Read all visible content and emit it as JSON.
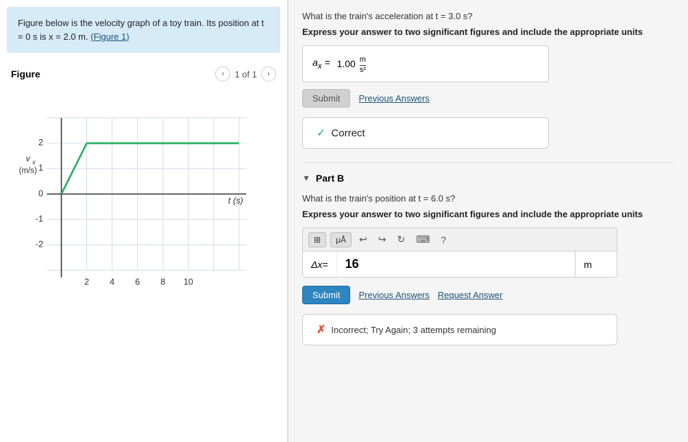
{
  "left": {
    "description": "Figure below is the velocity graph of a toy train. Its position at t = 0 s is x = 2.0 m.",
    "figure_link": "(Figure 1)",
    "figure_label": "Figure",
    "nav_text": "1 of 1",
    "graph": {
      "x_label": "t (s)",
      "y_label": "vₓ (m/s)",
      "x_ticks": [
        "2",
        "4",
        "6",
        "8",
        "10"
      ],
      "y_ticks": [
        "2",
        "1",
        "0",
        "-1",
        "-2"
      ]
    }
  },
  "right": {
    "part_a": {
      "question": "What is the train's acceleration at t = 3.0 s?",
      "instruction": "Express your answer to two significant figures and include the appropriate units",
      "answer_label": "aₓ =",
      "answer_value": "1.00",
      "answer_unit_num": "m",
      "answer_unit_den": "s²",
      "submit_label": "Submit",
      "prev_answers_label": "Previous Answers",
      "correct_label": "Correct"
    },
    "part_b": {
      "part_label": "Part B",
      "question": "What is the train's position at t = 6.0 s?",
      "instruction": "Express your answer to two significant figures and include the appropriate units",
      "toolbar_btns": [
        "⊞",
        "μÅ"
      ],
      "input_label": "Δx =",
      "input_value": "16",
      "input_unit": "m",
      "submit_label": "Submit",
      "prev_answers_label": "Previous Answers",
      "request_answer_label": "Request Answer",
      "incorrect_text": "Incorrect; Try Again; 3 attempts remaining"
    }
  }
}
